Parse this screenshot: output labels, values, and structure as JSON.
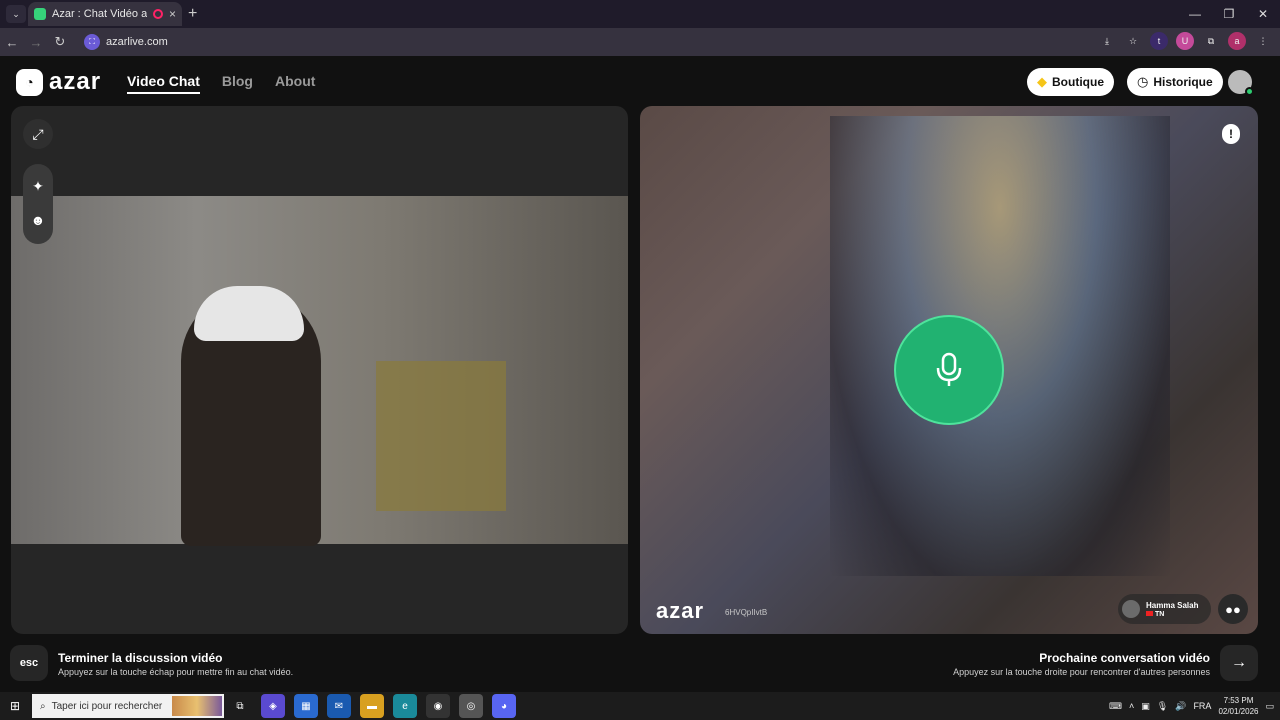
{
  "browser": {
    "tab_title": "Azar : Chat Vidéo avec de n",
    "tab_close": "×",
    "new_tab": "+",
    "url": "azarlive.com",
    "window_controls": [
      "—",
      "❐",
      "✕"
    ]
  },
  "header": {
    "logo_text": "azar",
    "nav": [
      {
        "label": "Video Chat",
        "active": true
      },
      {
        "label": "Blog",
        "active": false
      },
      {
        "label": "About",
        "active": false
      }
    ],
    "boutique_label": "Boutique",
    "historique_label": "Historique"
  },
  "remote": {
    "watermark": "azar",
    "watermark_id": "6HVQpIIvtB",
    "peer_name": "Hamma Salah",
    "peer_country": "TN"
  },
  "bottom": {
    "esc_key": "esc",
    "end_title": "Terminer la discussion vidéo",
    "end_sub": "Appuyez sur la touche échap pour mettre fin au chat vidéo.",
    "next_title": "Prochaine conversation vidéo",
    "next_sub": "Appuyez sur la touche droite pour rencontrer d'autres personnes"
  },
  "taskbar": {
    "search_placeholder": "Taper ici pour rechercher",
    "language": "FRA",
    "time": "7:53 PM",
    "date": "02/01/2026"
  },
  "colors": {
    "accent_green": "#21b271",
    "boutique_icon": "#f5c518"
  },
  "icons": [
    "expand-icon",
    "sparkle-icon",
    "face-filter-icon",
    "mic-icon",
    "report-icon",
    "chat-icon",
    "arrow-right-icon",
    "history-clock-icon",
    "diamond-icon"
  ]
}
